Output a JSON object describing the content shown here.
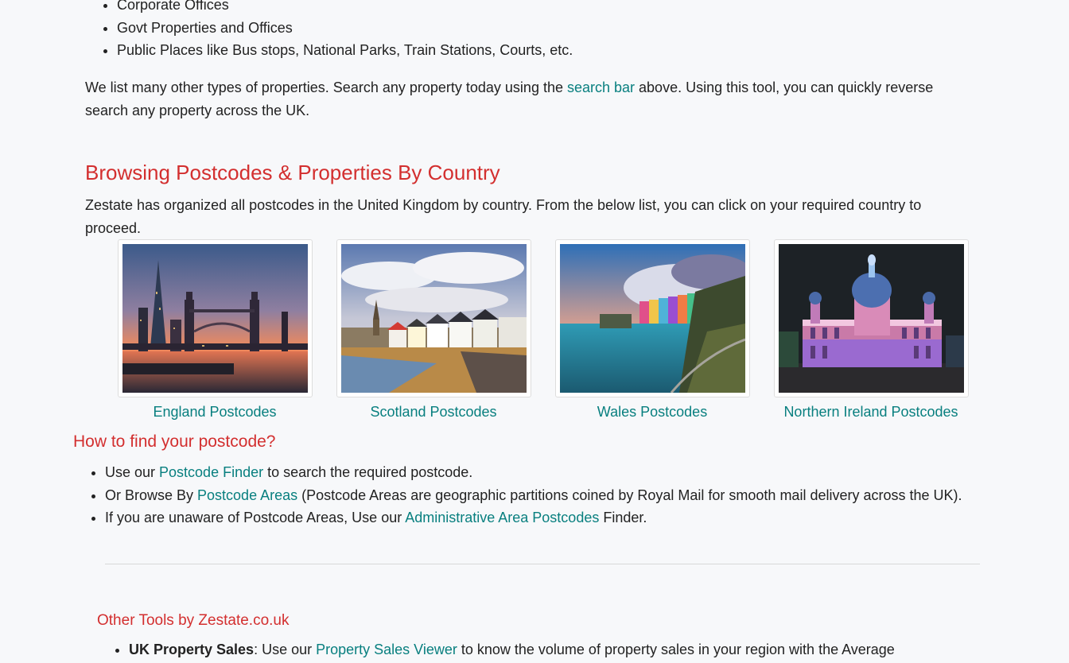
{
  "top_list": [
    "Corporate Offices",
    "Govt Properties and Offices",
    "Public Places like Bus stops, National Parks, Train Stations, Courts, etc."
  ],
  "para1": {
    "before": "We list many other types of properties. Search any property today using the ",
    "link": "search bar",
    "after": " above. Using this tool, you can quickly reverse search any property across the UK."
  },
  "country_section": {
    "title": "Browsing Postcodes & Properties By Country",
    "description": "Zestate has organized all postcodes in the United Kingdom by country. From the below list, you can click on your required country to proceed.",
    "countries": [
      {
        "label": "England Postcodes",
        "image": "london-tower-bridge-photo"
      },
      {
        "label": "Scotland Postcodes",
        "image": "scottish-coastal-village-photo"
      },
      {
        "label": "Wales Postcodes",
        "image": "welsh-harbour-town-photo"
      },
      {
        "label": "Northern Ireland Postcodes",
        "image": "belfast-city-hall-photo"
      }
    ]
  },
  "find_section": {
    "title": "How to find your postcode?",
    "items": [
      {
        "before": "Use our ",
        "link": "Postcode Finder",
        "after": " to search the required postcode."
      },
      {
        "before": "Or Browse By ",
        "link": "Postcode Areas",
        "after": " (Postcode Areas are geographic partitions coined by Royal Mail for smooth mail delivery across the UK)."
      },
      {
        "before": "If you are unaware of Postcode Areas, Use our ",
        "link": "Administrative Area Postcodes",
        "after": " Finder."
      }
    ]
  },
  "tools_section": {
    "title": "Other Tools by Zestate.co.uk",
    "items": [
      {
        "bold": "UK Property Sales",
        "before": ": Use our ",
        "link": "Property Sales Viewer",
        "after": " to know the volume of property sales in your region with the Average"
      }
    ]
  },
  "colors": {
    "heading": "#d32f2f",
    "link": "#087f7f",
    "text": "#222222",
    "background": "#f7f8fa"
  }
}
